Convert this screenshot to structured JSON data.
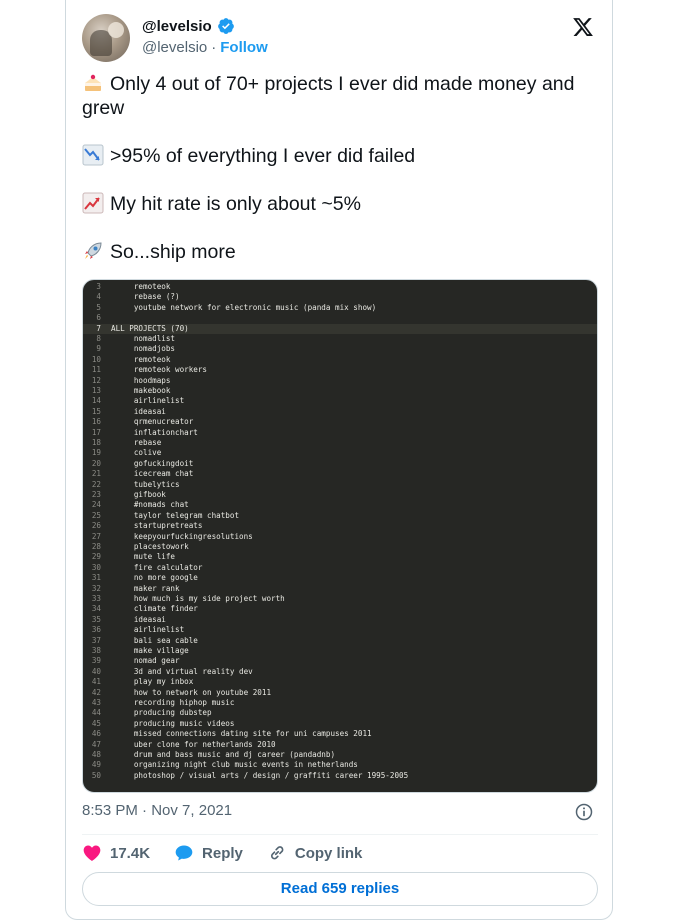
{
  "author": {
    "display_name": "@levelsio",
    "handle": "@levelsio",
    "separator": "·",
    "follow_label": "Follow"
  },
  "tweet": {
    "lines": [
      {
        "emoji": "cake-emoji",
        "text": "Only 4 out of 70+ projects I ever did made money and grew"
      },
      {
        "emoji": "chart-decreasing-emoji",
        "text": ">95% of everything I ever did failed"
      },
      {
        "emoji": "chart-increasing-emoji",
        "text": "My hit rate is only about ~5%"
      },
      {
        "emoji": "rocket-emoji",
        "text": "So...ship more"
      }
    ]
  },
  "code_image": {
    "lines": [
      {
        "n": "3",
        "text": "     remoteok"
      },
      {
        "n": "4",
        "text": "     rebase (?)"
      },
      {
        "n": "5",
        "text": "     youtube network for electronic music (panda mix show)"
      },
      {
        "n": "6",
        "text": ""
      },
      {
        "n": "7",
        "text": "ALL PROJECTS (70)"
      },
      {
        "n": "8",
        "text": "     nomadlist"
      },
      {
        "n": "9",
        "text": "     nomadjobs"
      },
      {
        "n": "10",
        "text": "     remoteok"
      },
      {
        "n": "11",
        "text": "     remoteok workers"
      },
      {
        "n": "12",
        "text": "     hoodmaps"
      },
      {
        "n": "13",
        "text": "     makebook"
      },
      {
        "n": "14",
        "text": "     airlinelist"
      },
      {
        "n": "15",
        "text": "     ideasai"
      },
      {
        "n": "16",
        "text": "     qrmenucreator"
      },
      {
        "n": "17",
        "text": "     inflationchart"
      },
      {
        "n": "18",
        "text": "     rebase"
      },
      {
        "n": "19",
        "text": "     colive"
      },
      {
        "n": "20",
        "text": "     gofuckingdoit"
      },
      {
        "n": "21",
        "text": "     icecream chat"
      },
      {
        "n": "22",
        "text": "     tubelytics"
      },
      {
        "n": "23",
        "text": "     gifbook"
      },
      {
        "n": "24",
        "text": "     #nomads chat"
      },
      {
        "n": "25",
        "text": "     taylor telegram chatbot"
      },
      {
        "n": "26",
        "text": "     startupretreats"
      },
      {
        "n": "27",
        "text": "     keepyourfuckingresolutions"
      },
      {
        "n": "28",
        "text": "     placestowork"
      },
      {
        "n": "29",
        "text": "     mute life"
      },
      {
        "n": "30",
        "text": "     fire calculator"
      },
      {
        "n": "31",
        "text": "     no more google"
      },
      {
        "n": "32",
        "text": "     maker rank"
      },
      {
        "n": "33",
        "text": "     how much is my side project worth"
      },
      {
        "n": "34",
        "text": "     climate finder"
      },
      {
        "n": "35",
        "text": "     ideasai"
      },
      {
        "n": "36",
        "text": "     airlinelist"
      },
      {
        "n": "37",
        "text": "     bali sea cable"
      },
      {
        "n": "38",
        "text": "     make village"
      },
      {
        "n": "39",
        "text": "     nomad gear"
      },
      {
        "n": "40",
        "text": "     3d and virtual reality dev"
      },
      {
        "n": "41",
        "text": "     play my inbox"
      },
      {
        "n": "42",
        "text": "     how to network on youtube 2011"
      },
      {
        "n": "43",
        "text": "     recording hiphop music"
      },
      {
        "n": "44",
        "text": "     producing dubstep"
      },
      {
        "n": "45",
        "text": "     producing music videos"
      },
      {
        "n": "46",
        "text": "     missed connections dating site for uni campuses 2011"
      },
      {
        "n": "47",
        "text": "     uber clone for netherlands 2010"
      },
      {
        "n": "48",
        "text": "     drum and bass music and dj career (pandadnb)"
      },
      {
        "n": "49",
        "text": "     organizing night club music events in netherlands"
      },
      {
        "n": "50",
        "text": "     photoshop / visual arts / design / graffiti career 1995-2005"
      }
    ],
    "current_line": "7"
  },
  "meta": {
    "time": "8:53 PM",
    "separator": "·",
    "date": "Nov 7, 2021"
  },
  "actions": {
    "likes": "17.4K",
    "reply_label": "Reply",
    "copy_link_label": "Copy link"
  },
  "read_replies_label": "Read 659 replies",
  "colors": {
    "accent": "#1d9bf0",
    "heart": "#f91880",
    "code_bg": "#262724"
  }
}
